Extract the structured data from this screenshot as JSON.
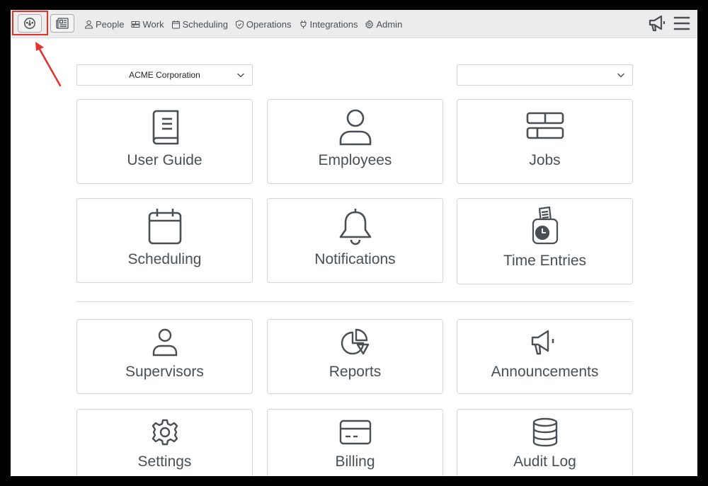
{
  "nav": {
    "items": [
      {
        "label": "People",
        "icon": "person-icon"
      },
      {
        "label": "Work",
        "icon": "work-icon"
      },
      {
        "label": "Scheduling",
        "icon": "calendar-icon"
      },
      {
        "label": "Operations",
        "icon": "shield-icon"
      },
      {
        "label": "Integrations",
        "icon": "plug-icon"
      },
      {
        "label": "Admin",
        "icon": "gear-icon"
      }
    ]
  },
  "filters": {
    "company": {
      "selected": "ACME Corporation"
    },
    "secondary": {
      "selected": ""
    }
  },
  "tiles": [
    {
      "label": "User Guide",
      "icon": "book-icon"
    },
    {
      "label": "Employees",
      "icon": "person-icon"
    },
    {
      "label": "Jobs",
      "icon": "jobs-icon"
    },
    {
      "label": "Scheduling",
      "icon": "calendar-icon"
    },
    {
      "label": "Notifications",
      "icon": "bell-icon"
    },
    {
      "label": "Time Entries",
      "icon": "time-clock-icon"
    },
    {
      "label": "Supervisors",
      "icon": "person-icon"
    },
    {
      "label": "Reports",
      "icon": "pie-chart-icon"
    },
    {
      "label": "Announcements",
      "icon": "megaphone-icon"
    },
    {
      "label": "Settings",
      "icon": "gear-icon"
    },
    {
      "label": "Billing",
      "icon": "credit-card-icon"
    },
    {
      "label": "Audit Log",
      "icon": "database-icon"
    }
  ],
  "colors": {
    "highlight": "#e0342c",
    "icon_stroke": "#4a4f55",
    "topbar_bg": "#ececec"
  }
}
